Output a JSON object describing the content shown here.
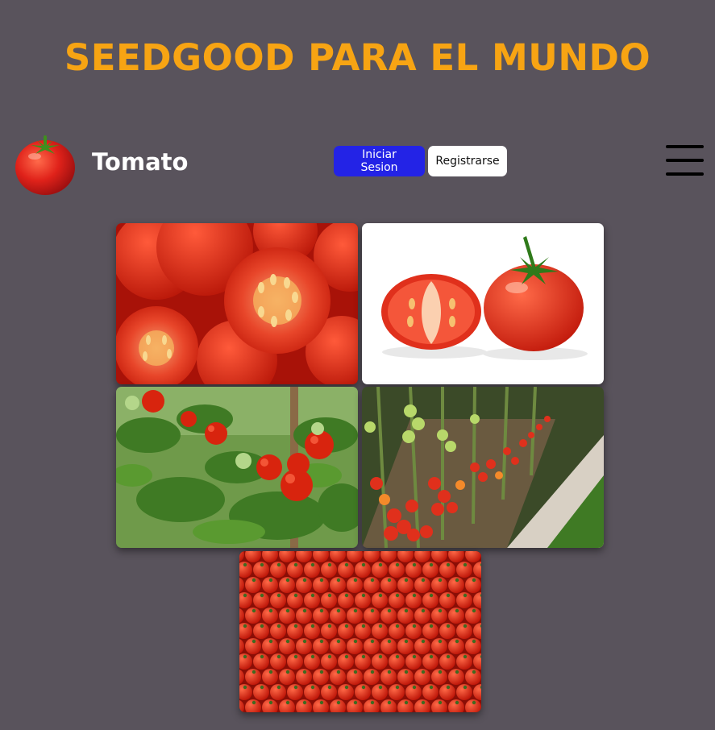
{
  "site": {
    "title": "SEEDGOOD PARA EL MUNDO"
  },
  "navbar": {
    "brand_name": "Tomato",
    "brand_logo_icon": "tomato-icon",
    "login_label": "Iniciar Sesion",
    "register_label": "Registrarse",
    "menu_icon": "hamburger-menu-icon"
  },
  "colors": {
    "background": "#59535c",
    "title": "#f7a413",
    "login_button": "#2323e6",
    "register_button": "#ffffff"
  },
  "gallery": {
    "images": [
      {
        "subject": "sliced-tomatoes-closeup"
      },
      {
        "subject": "halved-and-whole-tomato-on-white"
      },
      {
        "subject": "tomato-plant-with-fruit"
      },
      {
        "subject": "greenhouse-tomato-rows"
      },
      {
        "subject": "pile-of-cherry-tomatoes"
      }
    ]
  }
}
